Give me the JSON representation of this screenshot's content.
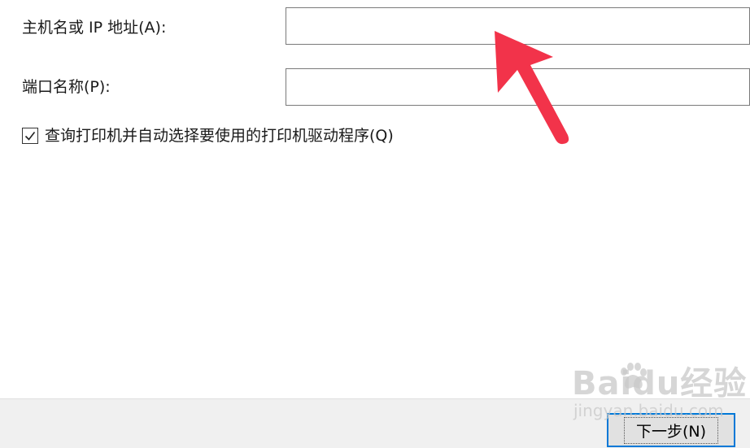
{
  "form": {
    "host_label": "主机名或 IP 地址(A):",
    "host_value": "",
    "port_label": "端口名称(P):",
    "port_value": "",
    "query_checkbox_label": "查询打印机并自动选择要使用的打印机驱动程序(Q)",
    "query_checkbox_checked": true
  },
  "footer": {
    "next_button_label": "下一步(N)"
  },
  "watermark": {
    "brand": "Baidu经验",
    "site": "jingyan.baidu.com"
  },
  "colors": {
    "annotation_arrow": "#f2334a",
    "button_focus_border": "#0078d7",
    "footer_bg": "#f0f0f0"
  },
  "icons": {
    "checkbox": "check-icon",
    "annotation": "arrow-pointer-icon"
  }
}
